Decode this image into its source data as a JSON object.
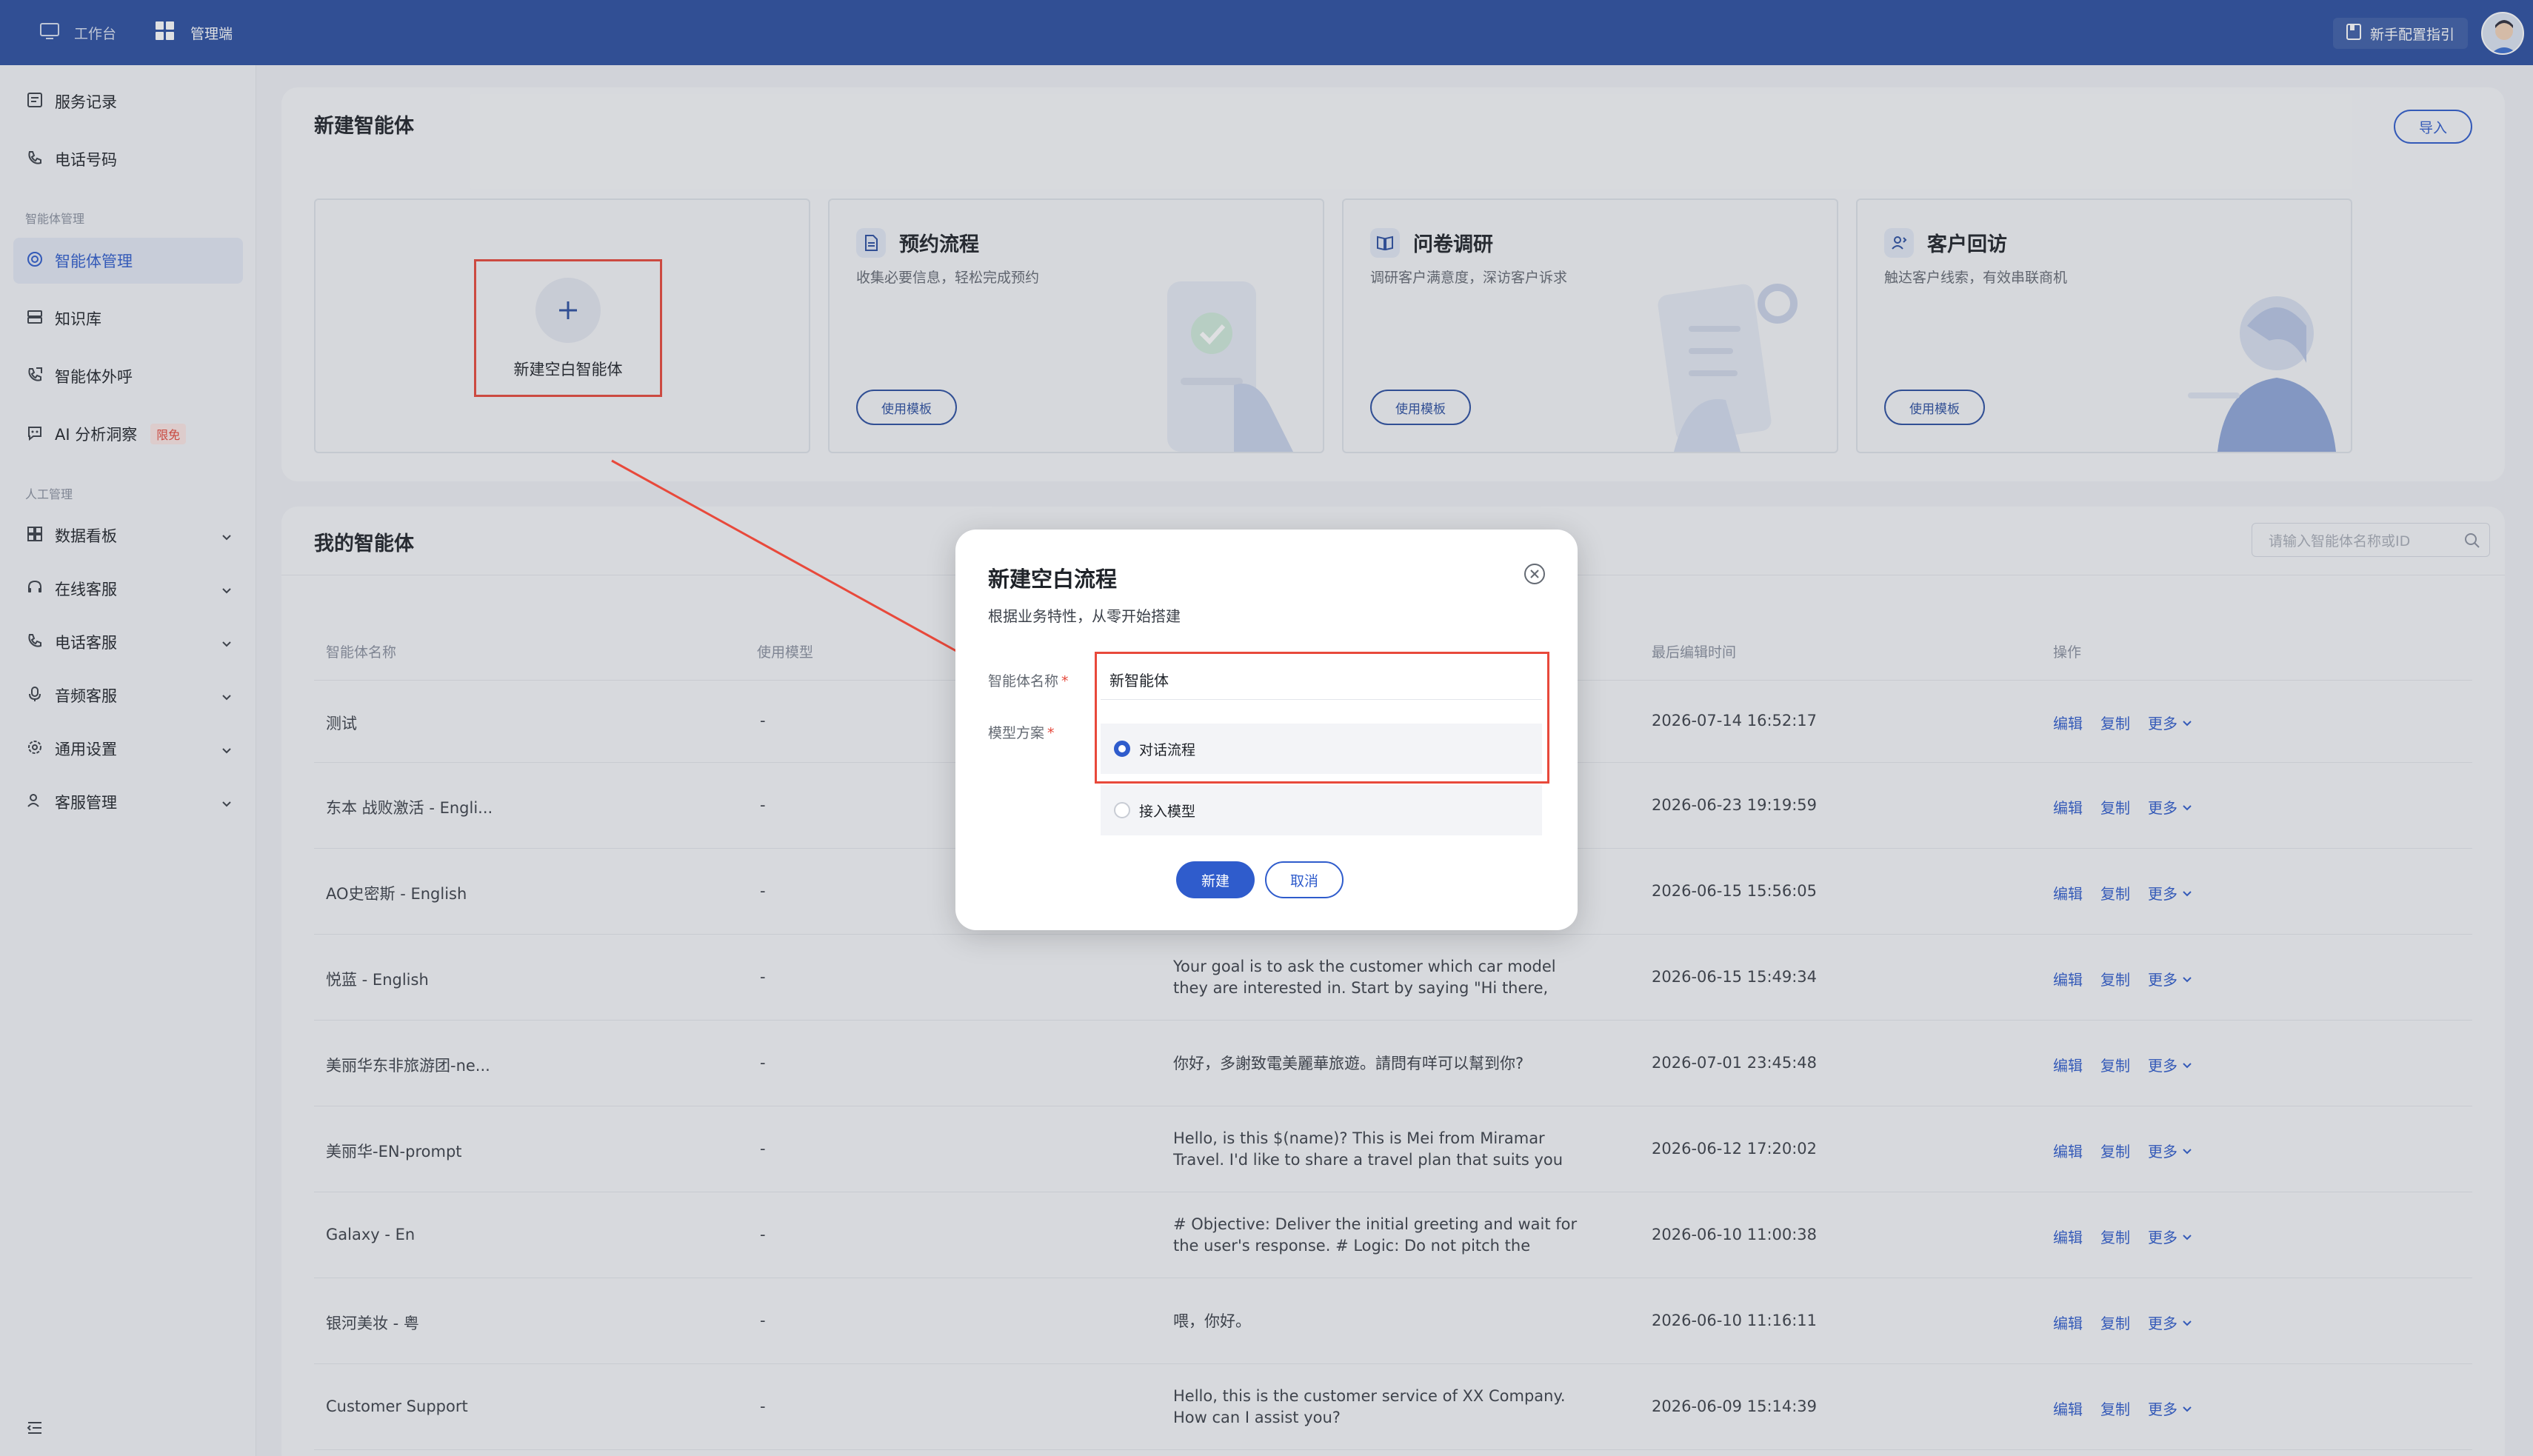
{
  "topbar": {
    "tabs": [
      {
        "label": "工作台",
        "icon": "monitor-icon"
      },
      {
        "label": "管理端",
        "icon": "grid-icon"
      }
    ],
    "guide_label": "新手配置指引"
  },
  "sidebar": {
    "items_top": [
      {
        "label": "服务记录",
        "icon": "record-icon"
      },
      {
        "label": "电话号码",
        "icon": "phone-icon"
      }
    ],
    "group_agent": "智能体管理",
    "items_agent": [
      {
        "label": "智能体管理",
        "icon": "agent-icon",
        "active": true
      },
      {
        "label": "知识库",
        "icon": "database-icon"
      },
      {
        "label": "智能体外呼",
        "icon": "outbound-call-icon"
      },
      {
        "label": "AI 分析洞察",
        "icon": "ai-insight-icon",
        "badge": "限免"
      }
    ],
    "group_manual": "人工管理",
    "items_manual": [
      {
        "label": "数据看板",
        "icon": "dashboard-icon"
      },
      {
        "label": "在线客服",
        "icon": "headset-icon"
      },
      {
        "label": "电话客服",
        "icon": "phone-service-icon"
      },
      {
        "label": "音频客服",
        "icon": "microphone-icon"
      },
      {
        "label": "通用设置",
        "icon": "settings-icon"
      },
      {
        "label": "客服管理",
        "icon": "staff-icon"
      }
    ]
  },
  "create_panel": {
    "title": "新建智能体",
    "import_label": "导入",
    "blank_label": "新建空白智能体",
    "templates": [
      {
        "title": "预约流程",
        "desc": "收集必要信息，轻松完成预约",
        "button": "使用模板",
        "icon": "document-icon"
      },
      {
        "title": "问卷调研",
        "desc": "调研客户满意度，深访客户诉求",
        "button": "使用模板",
        "icon": "survey-icon"
      },
      {
        "title": "客户回访",
        "desc": "触达客户线索，有效串联商机",
        "button": "使用模板",
        "icon": "callback-icon"
      }
    ]
  },
  "list_panel": {
    "title": "我的智能体",
    "search_placeholder": "请输入智能体名称或ID",
    "columns": [
      "智能体名称",
      "使用模型",
      "最后编辑时间",
      "操作"
    ],
    "ops": {
      "edit": "编辑",
      "copy": "复制",
      "more": "更多"
    },
    "rows": [
      {
        "name": "测试",
        "model": "-",
        "prompt": "",
        "time": "2026-07-14 16:52:17"
      },
      {
        "name": "东本 战败激活 - Engli...",
        "model": "-",
        "prompt": "",
        "time": "2026-06-23 19:19:59"
      },
      {
        "name": "AO史密斯 - English",
        "model": "-",
        "prompt": "",
        "time": "2026-06-15 15:56:05"
      },
      {
        "name": "悦蓝 - English",
        "model": "-",
        "prompt": "Your goal is to ask the customer which car model they are interested in. Start by saying \"Hi there, we're from the...",
        "time": "2026-06-15 15:49:34"
      },
      {
        "name": "美丽华东非旅游团-ne...",
        "model": "-",
        "prompt": "你好，多謝致電美麗華旅遊。請問有咩可以幫到你?",
        "time": "2026-07-01 23:45:48"
      },
      {
        "name": "美丽华-EN-prompt",
        "model": "-",
        "prompt": "Hello, is this $(name)? This is Mei from Miramar Travel. I'd like to share a travel plan that suits you well. Do you hav...",
        "time": "2026-06-12 17:20:02"
      },
      {
        "name": "Galaxy - En",
        "model": "-",
        "prompt": "# Objective: Deliver the initial greeting and wait for the user's response. # Logic: Do not pitch the product yet....",
        "time": "2026-06-10 11:00:38"
      },
      {
        "name": "银河美妆 - 粤",
        "model": "-",
        "prompt": "喂，你好。",
        "time": "2026-06-10 11:16:11"
      },
      {
        "name": "Customer Support",
        "model": "-",
        "prompt": "Hello, this is the customer service of XX Company. How can I assist you?",
        "time": "2026-06-09 15:14:39"
      }
    ]
  },
  "modal": {
    "title": "新建空白流程",
    "subtitle": "根据业务特性，从零开始搭建",
    "name_label": "智能体名称",
    "name_value": "新智能体",
    "model_label": "模型方案",
    "options": [
      "对话流程",
      "接入模型"
    ],
    "selected_option": "对话流程",
    "create_label": "新建",
    "cancel_label": "取消"
  },
  "colors": {
    "brand": "#2b4fa0",
    "accent": "#2f5ccc",
    "highlight": "#e8493b"
  }
}
